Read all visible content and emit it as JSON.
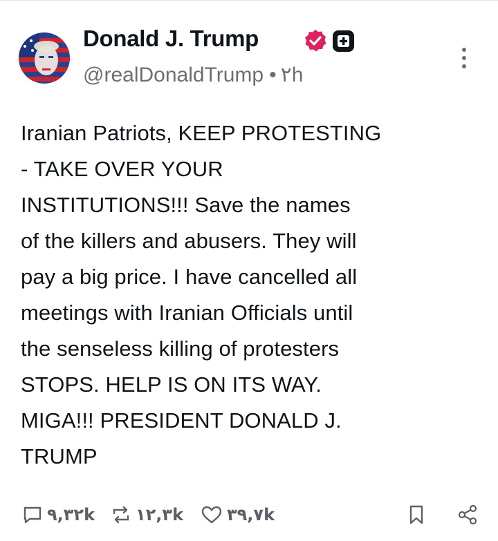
{
  "post": {
    "author": {
      "name": "Donald J. Trump",
      "handle": "@realDonaldTrump",
      "separator": "•",
      "time": "۲h",
      "verified_icon": "verified-badge-icon",
      "plus_icon": "plus-badge-icon"
    },
    "text": "Iranian Patriots, KEEP PROTESTING\n- TAKE OVER YOUR\nINSTITUTIONS!!! Save the names\nof the killers and abusers. They will\npay a big price. I have cancelled all\nmeetings with Iranian Officials until\nthe senseless killing of protesters\nSTOPS. HELP IS ON ITS WAY.\nMIGA!!! PRESIDENT DONALD J.\nTRUMP",
    "actions": {
      "replies": "۹,۳۲k",
      "reposts": "۱۲,۳k",
      "likes": "۳۹,۷k"
    }
  },
  "colors": {
    "verified": "#e0215f",
    "muted": "#6b6f74",
    "text": "#0f1419"
  }
}
